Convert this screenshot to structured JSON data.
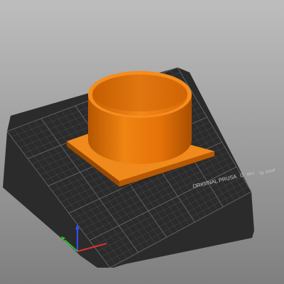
{
  "scene": {
    "background_top": "#bdbdbd",
    "background_bottom": "#7f7f7f",
    "bed_color": "#2b2b2b",
    "grid_color": "#6e6e6e",
    "model_color": "#e87408",
    "bed_label_line1_a": "ORIGINAL PRUSA",
    "bed_label_line1_b": "i3",
    "bed_label_line1_c": "MK3",
    "bed_label_line2": "by Josef",
    "axis_x_color": "#e03030",
    "axis_y_color": "#30c030",
    "axis_z_color": "#3050ff"
  }
}
